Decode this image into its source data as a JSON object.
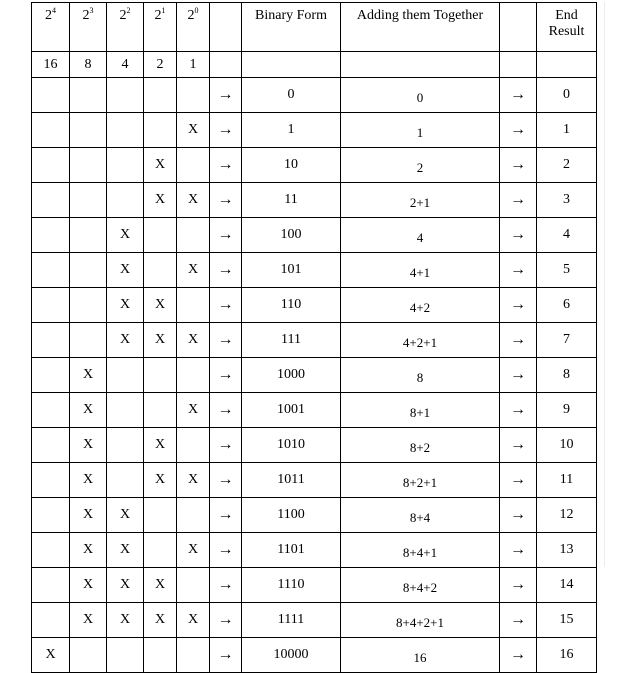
{
  "header": {
    "powers": [
      {
        "base": "2",
        "exp": "4"
      },
      {
        "base": "2",
        "exp": "3"
      },
      {
        "base": "2",
        "exp": "2"
      },
      {
        "base": "2",
        "exp": "1"
      },
      {
        "base": "2",
        "exp": "0"
      }
    ],
    "binary_form": "Binary Form",
    "adding": "Adding them Together",
    "end_result_line1": "End",
    "end_result_line2": "Result"
  },
  "place_values": [
    "16",
    "8",
    "4",
    "2",
    "1"
  ],
  "arrow": "→",
  "rows": [
    {
      "marks": [
        "",
        "",
        "",
        "",
        ""
      ],
      "binary": "0",
      "sum": "0",
      "result": "0"
    },
    {
      "marks": [
        "",
        "",
        "",
        "",
        "X"
      ],
      "binary": "1",
      "sum": "1",
      "result": "1"
    },
    {
      "marks": [
        "",
        "",
        "",
        "X",
        ""
      ],
      "binary": "10",
      "sum": "2",
      "result": "2"
    },
    {
      "marks": [
        "",
        "",
        "",
        "X",
        "X"
      ],
      "binary": "11",
      "sum": "2+1",
      "result": "3"
    },
    {
      "marks": [
        "",
        "",
        "X",
        "",
        ""
      ],
      "binary": "100",
      "sum": "4",
      "result": "4"
    },
    {
      "marks": [
        "",
        "",
        "X",
        "",
        "X"
      ],
      "binary": "101",
      "sum": "4+1",
      "result": "5"
    },
    {
      "marks": [
        "",
        "",
        "X",
        "X",
        ""
      ],
      "binary": "110",
      "sum": "4+2",
      "result": "6"
    },
    {
      "marks": [
        "",
        "",
        "X",
        "X",
        "X"
      ],
      "binary": "111",
      "sum": "4+2+1",
      "result": "7"
    },
    {
      "marks": [
        "",
        "X",
        "",
        "",
        ""
      ],
      "binary": "1000",
      "sum": "8",
      "result": "8"
    },
    {
      "marks": [
        "",
        "X",
        "",
        "",
        "X"
      ],
      "binary": "1001",
      "sum": "8+1",
      "result": "9"
    },
    {
      "marks": [
        "",
        "X",
        "",
        "X",
        ""
      ],
      "binary": "1010",
      "sum": "8+2",
      "result": "10"
    },
    {
      "marks": [
        "",
        "X",
        "",
        "X",
        "X"
      ],
      "binary": "1011",
      "sum": "8+2+1",
      "result": "11"
    },
    {
      "marks": [
        "",
        "X",
        "X",
        "",
        ""
      ],
      "binary": "1100",
      "sum": "8+4",
      "result": "12"
    },
    {
      "marks": [
        "",
        "X",
        "X",
        "",
        "X"
      ],
      "binary": "1101",
      "sum": "8+4+1",
      "result": "13"
    },
    {
      "marks": [
        "",
        "X",
        "X",
        "X",
        ""
      ],
      "binary": "1110",
      "sum": "8+4+2",
      "result": "14"
    },
    {
      "marks": [
        "",
        "X",
        "X",
        "X",
        "X"
      ],
      "binary": "1111",
      "sum": "8+4+2+1",
      "result": "15"
    },
    {
      "marks": [
        "X",
        "",
        "",
        "",
        ""
      ],
      "binary": "10000",
      "sum": "16",
      "result": "16"
    }
  ]
}
